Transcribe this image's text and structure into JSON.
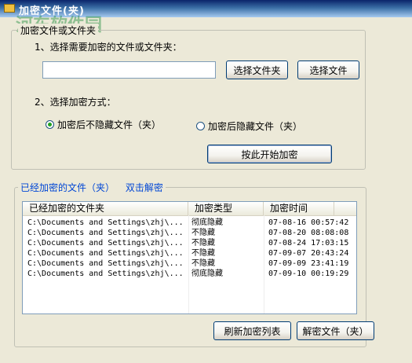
{
  "window": {
    "title": "加密文件(夹)",
    "watermark": "河东软件园"
  },
  "group_top": {
    "legend": "加密文件或文件夹",
    "step1_label": "1、选择需要加密的文件或文件夹：",
    "path_value": "",
    "select_folder_btn": "选择文件夹",
    "select_file_btn": "选择文件",
    "step2_label": "2、选择加密方式：",
    "radio_keep_visible": "加密后不隐藏文件（夹）",
    "radio_hide": "加密后隐藏文件（夹）",
    "start_encrypt_btn": "按此开始加密"
  },
  "group_bottom": {
    "legend_list": "已经加密的文件（夹）",
    "legend_hint": "双击解密",
    "columns": [
      "已经加密的文件夹",
      "加密类型",
      "加密时间"
    ],
    "rows": [
      {
        "path": "C:\\Documents and Settings\\zhj\\...",
        "type": "彻底隐藏",
        "time": "07-08-16 00:57:42"
      },
      {
        "path": "C:\\Documents and Settings\\zhj\\...",
        "type": "不隐藏",
        "time": "07-08-20 08:08:08"
      },
      {
        "path": "C:\\Documents and Settings\\zhj\\...",
        "type": "不隐藏",
        "time": "07-08-24 17:03:15"
      },
      {
        "path": "C:\\Documents and Settings\\zhj\\...",
        "type": "不隐藏",
        "time": "07-09-07 20:43:24"
      },
      {
        "path": "C:\\Documents and Settings\\zhj\\...",
        "type": "不隐藏",
        "time": "07-09-09 23:41:19"
      },
      {
        "path": "C:\\Documents and Settings\\zhj\\...",
        "type": "彻底隐藏",
        "time": "07-09-10 00:19:29"
      }
    ],
    "refresh_btn": "刷新加密列表",
    "decrypt_btn": "解密文件（夹）"
  },
  "colors": {
    "accent_blue": "#0046d5",
    "radio_check": "#21a121"
  }
}
